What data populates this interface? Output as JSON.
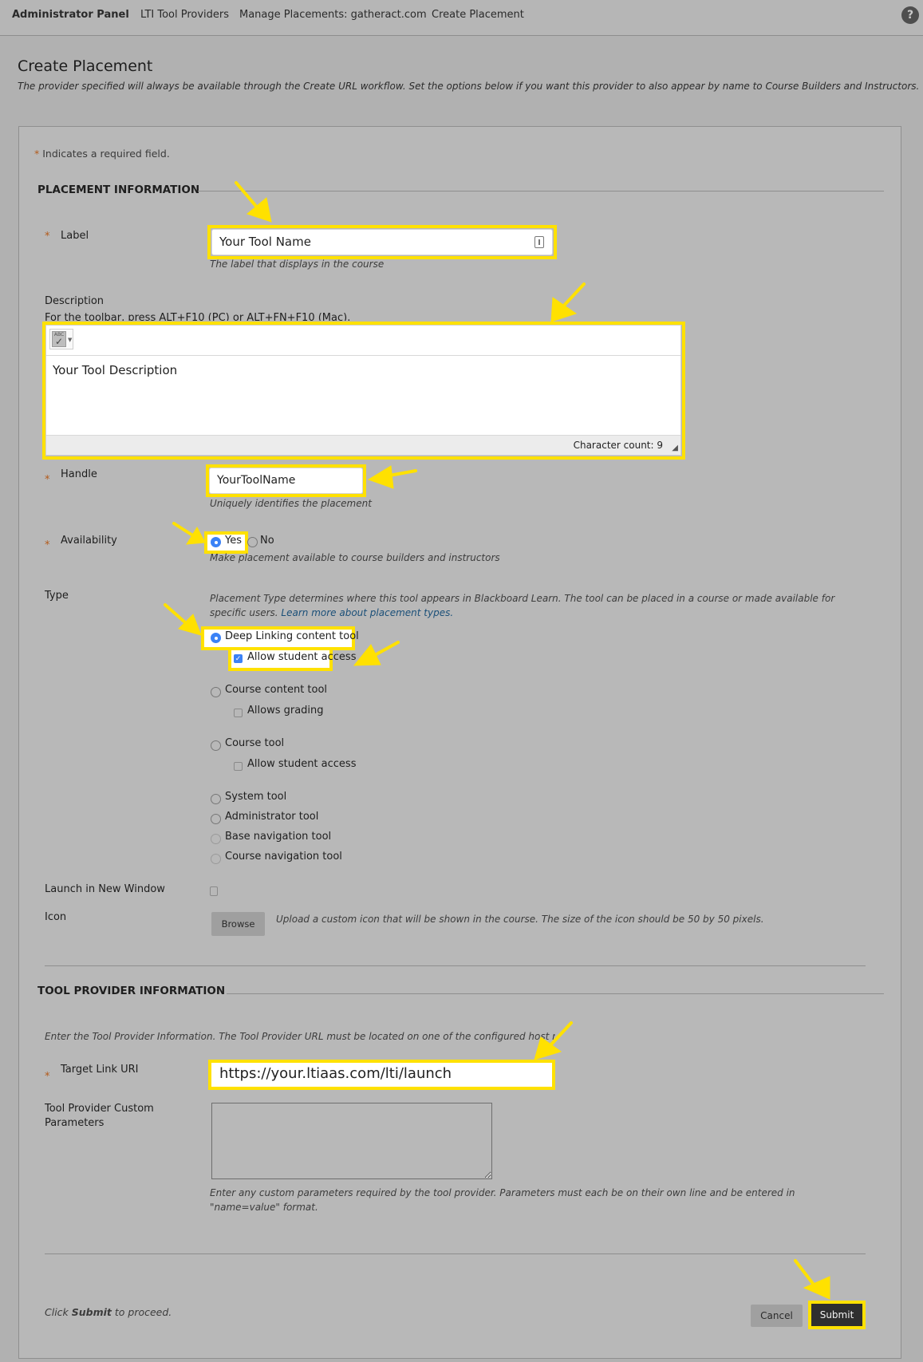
{
  "breadcrumb": [
    "Administrator Panel",
    "LTI Tool Providers",
    "Manage Placements: gatheract.com",
    "Create Placement"
  ],
  "help_icon": "?",
  "page": {
    "title": "Create Placement",
    "subtitle": "The provider specified will always be available through the Create URL workflow. Set the options below if you want this provider to also appear by name to Course Builders and Instructors."
  },
  "required_note": {
    "star": "*",
    "text": "Indicates a required field."
  },
  "placement_section": {
    "title": "PLACEMENT INFORMATION",
    "label": {
      "label": "Label",
      "value": "Your Tool Name",
      "hint": "The label that displays in the course"
    },
    "description": {
      "label": "Description",
      "toolbar_hint": "For the toolbar, press ALT+F10 (PC) or ALT+FN+F10 (Mac).",
      "value": "Your Tool Description",
      "char_count": "Character count: 9"
    },
    "handle": {
      "label": "Handle",
      "value": "YourToolName",
      "hint": "Uniquely identifies the placement"
    },
    "availability": {
      "label": "Availability",
      "options": [
        "Yes",
        "No"
      ],
      "selected": "Yes",
      "hint": "Make placement available to course builders and instructors"
    },
    "type": {
      "label": "Type",
      "hint": "Placement Type determines where this tool appears in Blackboard Learn. The tool can be placed in a course or made available for specific users.",
      "hint_link": "Learn more about placement types.",
      "options": [
        {
          "label": "Deep Linking content tool",
          "selected": true,
          "sub": {
            "label": "Allow student access",
            "checked": true
          }
        },
        {
          "label": "Course content tool",
          "selected": false,
          "sub": {
            "label": "Allows grading",
            "checked": false
          }
        },
        {
          "label": "Course tool",
          "selected": false,
          "sub": {
            "label": "Allow student access",
            "checked": false
          }
        },
        {
          "label": "System tool",
          "selected": false
        },
        {
          "label": "Administrator tool",
          "selected": false
        },
        {
          "label": "Base navigation tool",
          "selected": false
        },
        {
          "label": "Course navigation tool",
          "selected": false
        }
      ]
    },
    "launch_new_window": {
      "label": "Launch in New Window",
      "checked": false
    },
    "icon": {
      "label": "Icon",
      "button": "Browse",
      "hint": "Upload a custom icon that will be shown in the course. The size of the icon should be 50 by 50 pixels."
    }
  },
  "provider_section": {
    "title": "TOOL PROVIDER INFORMATION",
    "intro": "Enter the Tool Provider Information. The Tool Provider URL must be located on one of the configured host names.",
    "target_link": {
      "label": "Target Link URI",
      "value": "https://your.ltiaas.com/lti/launch"
    },
    "custom_params": {
      "label_line1": "Tool Provider Custom",
      "label_line2": "Parameters",
      "value": "",
      "hint": "Enter any custom parameters required by the tool provider. Parameters must each be on their own line and be entered in \"name=value\" format."
    }
  },
  "footer": {
    "note_prefix": "Click ",
    "note_bold": "Submit",
    "note_suffix": " to proceed.",
    "cancel": "Cancel",
    "submit": "Submit"
  },
  "colors": {
    "highlight": "#ffe100",
    "accent": "#3b82f6",
    "required": "#b35a1a",
    "submit_bg": "#2f2f2f"
  }
}
